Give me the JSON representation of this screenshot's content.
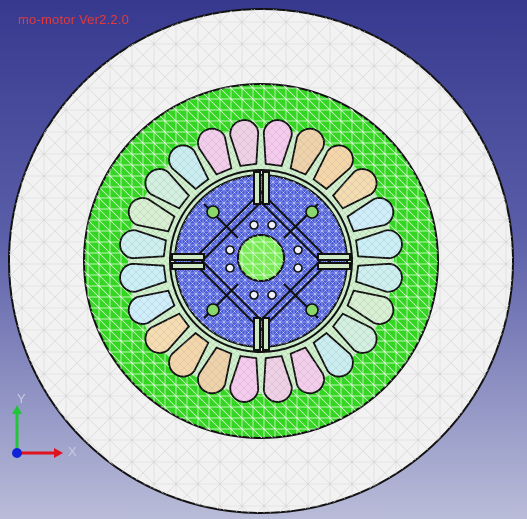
{
  "app": {
    "title": "mo-motor Ver2.2.0",
    "title_color": "#e23a3a"
  },
  "axes": {
    "x_label": "X",
    "y_label": "Y",
    "x_color": "#e0121e",
    "y_color": "#22c43a",
    "z_color": "#1022d8"
  },
  "model": {
    "colors": {
      "outer_region": "#f2f2f2",
      "stator_core": "#35d623",
      "airgap": "#d2f0d0",
      "rotor_core": "#4a5bd8",
      "shaft": "#7aea56",
      "hole": "#8ad86c",
      "outline": "#111111"
    },
    "slot_count": 24,
    "slot_colors": [
      "#f6c9ee",
      "#f0d2a8",
      "#f6d6a6",
      "#f4dcae",
      "#cfeefc",
      "#c9f0f6",
      "#cceff0",
      "#d8f0d2",
      "#d2f0e0",
      "#c8eef2",
      "#f3cdeb",
      "#f0d0e6",
      "#f6c9ee",
      "#f0d2a8",
      "#f4d6a8",
      "#f6dcae",
      "#cfeefc",
      "#c9f0f6",
      "#cceff0",
      "#d8f0d2",
      "#d2f0e0",
      "#c8eef2",
      "#f3cdeb",
      "#f0d0e6"
    ]
  }
}
